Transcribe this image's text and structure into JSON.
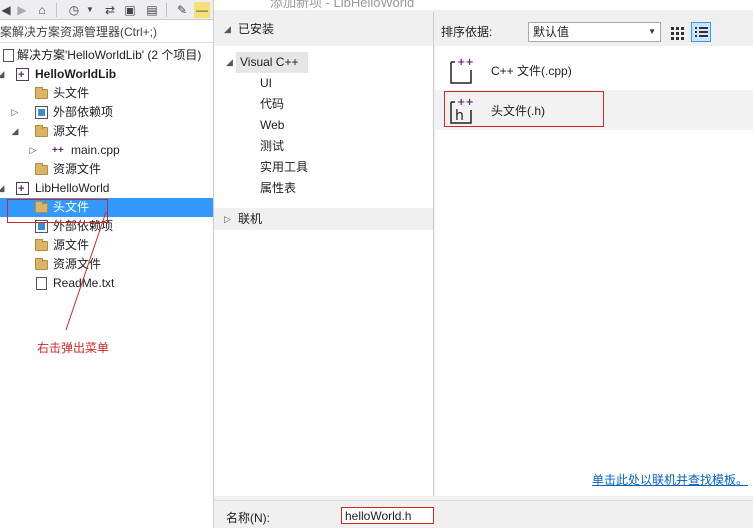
{
  "solution_explorer": {
    "search_placeholder": "搜索解决方案资源管理器(Ctrl+;)",
    "search_visible": "案解决方案资源管理器(Ctrl+;)",
    "tree": [
      {
        "label": "解决方案'HelloWorldLib' (2 个项目)",
        "kind": "solution"
      },
      {
        "label": "HelloWorldLib",
        "kind": "project",
        "bold": true
      },
      {
        "label": "头文件",
        "kind": "folder"
      },
      {
        "label": "外部依赖项",
        "kind": "ext"
      },
      {
        "label": "源文件",
        "kind": "folder"
      },
      {
        "label": "main.cpp",
        "kind": "cpp"
      },
      {
        "label": "资源文件",
        "kind": "folder"
      },
      {
        "label": "LibHelloWorld",
        "kind": "project"
      },
      {
        "label": "头文件",
        "kind": "folder",
        "selected": true
      },
      {
        "label": "外部依赖项",
        "kind": "ext"
      },
      {
        "label": "源文件",
        "kind": "folder"
      },
      {
        "label": "资源文件",
        "kind": "folder"
      },
      {
        "label": "ReadMe.txt",
        "kind": "file"
      }
    ]
  },
  "dialog": {
    "title": "添加新项 - LibHelloWorld",
    "categories": {
      "installed": "已安装",
      "visual_cpp": "Visual C++",
      "children": [
        "UI",
        "代码",
        "Web",
        "测试",
        "实用工具",
        "属性表"
      ],
      "online": "联机"
    },
    "sort_label": "排序依据:",
    "sort_value": "默认值",
    "templates": [
      {
        "name": "C++ 文件(.cpp)"
      },
      {
        "name": "头文件(.h)",
        "selected": true
      }
    ],
    "online_link": "单击此处以联机并查找模板。",
    "name_label": "名称(N):",
    "name_value": "helloWorld.h"
  },
  "annotation": {
    "text": "右击弹出菜单"
  },
  "colors": {
    "selection": "#3399ff",
    "annotation_red": "#d02828",
    "link": "#0563c1"
  }
}
